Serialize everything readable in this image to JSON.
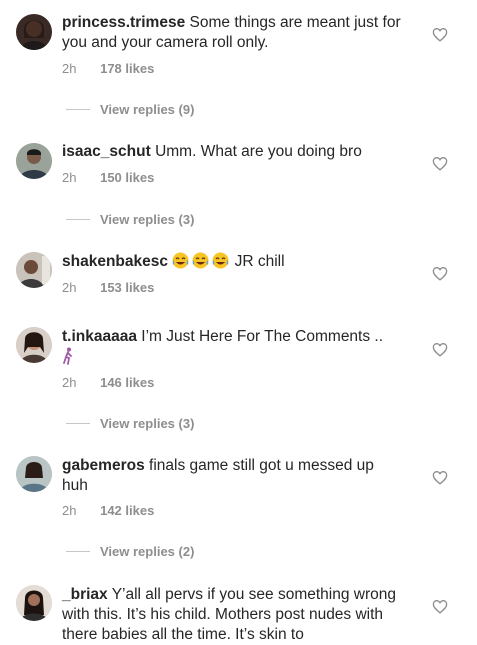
{
  "comments": [
    {
      "username": "princess.trimese",
      "text": "Some things are meant just for you and your camera roll only.",
      "time": "2h",
      "likes": "178 likes",
      "replies": "View replies (9)"
    },
    {
      "username": "isaac_schut",
      "text": "Umm. What are you doing bro",
      "time": "2h",
      "likes": "150 likes",
      "replies": "View replies (3)"
    },
    {
      "username": "shakenbakesc",
      "emoji": [
        "face-with-tears-of-joy-icon",
        "face-with-tears-of-joy-icon",
        "face-with-tears-of-joy-icon"
      ],
      "text": " JR chill",
      "time": "2h",
      "likes": "153 likes"
    },
    {
      "username": "t.inkaaaaa",
      "text": "I’m Just Here For The Comments ..",
      "emoji": [
        "person-walking-icon"
      ],
      "time": "2h",
      "likes": "146 likes",
      "replies": "View replies (3)"
    },
    {
      "username": "gabemeros",
      "text": "finals game still got u messed up huh",
      "time": "2h",
      "likes": "142 likes",
      "replies": "View replies (2)"
    },
    {
      "username": "_briax",
      "text": "Y’all all pervs if you see something wrong with this. It’s his child. Mothers post nudes with there babies all the time. It’s skin to"
    }
  ]
}
